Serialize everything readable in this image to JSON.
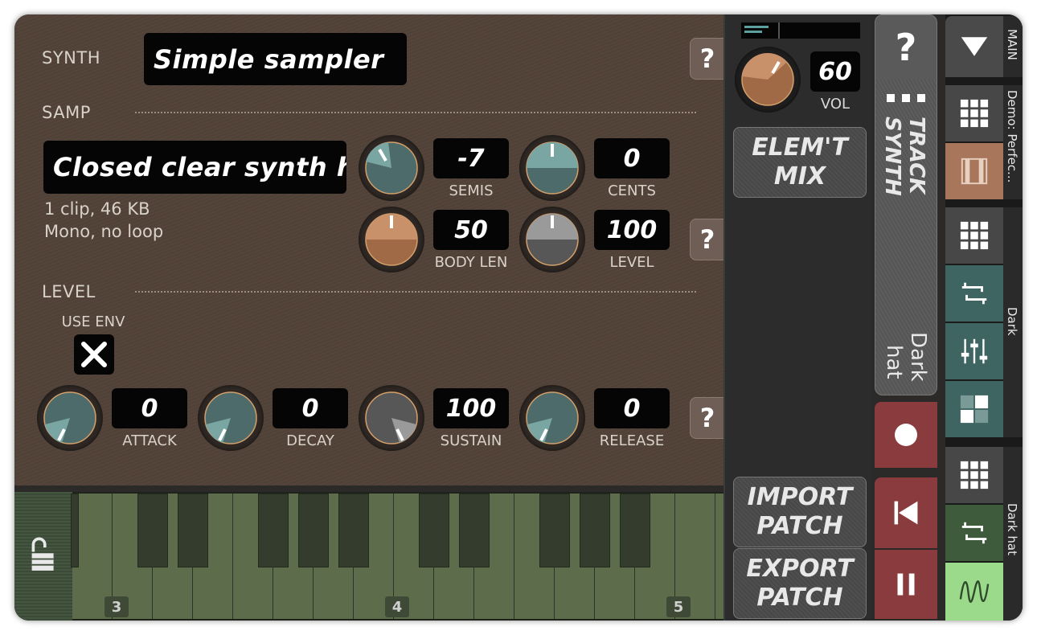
{
  "synth": {
    "label": "SYNTH",
    "name": "Simple sampler"
  },
  "samp": {
    "section_label": "SAMP",
    "sample_name": "Closed clear synth h",
    "info_line1": "1 clip, 46 KB",
    "info_line2": "Mono, no loop",
    "knobs": [
      {
        "label": "SEMIS",
        "value": "-7",
        "fill": "#4d6b6a",
        "accent": "#79a6a3"
      },
      {
        "label": "CENTS",
        "value": "0",
        "fill": "#4d6b6a",
        "accent": "#79a6a3"
      },
      {
        "label": "BODY LEN",
        "value": "50",
        "fill": "#a06a47",
        "accent": "#c8916a"
      },
      {
        "label": "LEVEL",
        "value": "100",
        "fill": "#575757",
        "accent": "#9a9a9a"
      }
    ]
  },
  "level": {
    "section_label": "LEVEL",
    "use_env_label": "USE ENV",
    "use_env_checked": true,
    "knobs": [
      {
        "label": "ATTACK",
        "value": "0"
      },
      {
        "label": "DECAY",
        "value": "0"
      },
      {
        "label": "SUSTAIN",
        "value": "100"
      },
      {
        "label": "RELEASE",
        "value": "0"
      }
    ]
  },
  "help_label": "?",
  "keyboard": {
    "octave_labels": [
      "3",
      "4",
      "5"
    ]
  },
  "right_panel": {
    "vol_value": "60",
    "vol_label": "VOL",
    "elem_mix_line1": "ELEM'T",
    "elem_mix_line2": "MIX",
    "import_line1": "IMPORT",
    "import_line2": "PATCH",
    "export_line1": "EXPORT",
    "export_line2": "PATCH"
  },
  "synth_column": {
    "help_label": "?",
    "title_line1": "TRACK",
    "title_line2": "SYNTH",
    "preset_line1": "Dark",
    "preset_line2": "hat"
  },
  "tracks": {
    "main_label": "MAIN",
    "group1_label": "Demo: Perfec...",
    "group2_label": "Dark",
    "group3_label": "Dark hat"
  },
  "colors": {
    "teal": "#3e6562",
    "teal_dark": "#355652",
    "copper": "#a8765b",
    "green": "#3e5c3c",
    "green_light": "#9bd98b",
    "transport_red": "#8a3b3e"
  }
}
